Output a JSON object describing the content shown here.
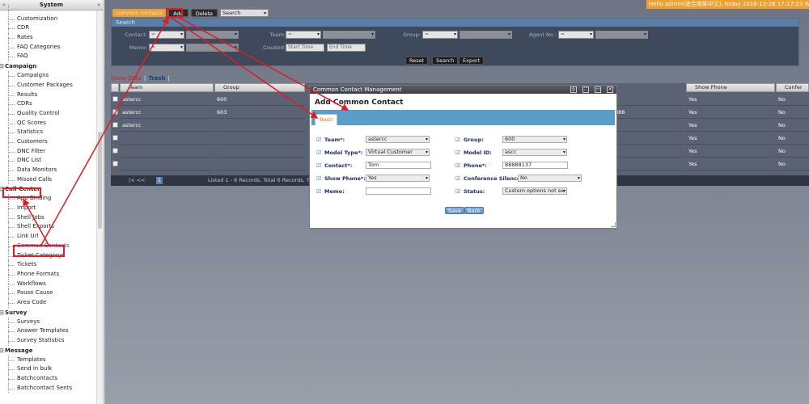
{
  "sidebar": {
    "title": "System",
    "collapse_left": "«",
    "collapse_right": "«",
    "groups": [
      {
        "label": "",
        "items": [
          "",
          "Customization",
          "CDR",
          "Rates",
          "FAQ Categories",
          "FAQ"
        ]
      },
      {
        "label": "Campaign",
        "items": [
          "Campaigns",
          "Customer Packages",
          "Results",
          "CDRs",
          "Quality Control",
          "QC Scores",
          "Statistics",
          "Customers",
          "DNC Filter",
          "DNC List",
          "Data Monitors",
          "Missed Calls"
        ]
      },
      {
        "label": "Call Center",
        "items": [
          "App Binding",
          "Import",
          "Shell Jobs",
          "Shell Exports",
          "Link Url",
          "Common Contacts",
          "Ticket Categorys",
          "Tickets",
          "Phone Formats",
          "Workflows",
          "Pause Cause",
          "Area Code"
        ]
      },
      {
        "label": "Survey",
        "items": [
          "Surveys",
          "Answer Templates",
          "Survey Statistics"
        ]
      },
      {
        "label": "Message",
        "items": [
          "Templates",
          "Send in bulk",
          "Batchcontacts",
          "Batchcontact Sents"
        ]
      }
    ]
  },
  "topbar": {
    "greeting": "Hello admin(适合简体中文), today 2016-12-28 17:17:23 Wednes"
  },
  "toolbar": {
    "tag": "common contacts",
    "add_label": "Add",
    "delete_label": "Delete",
    "search_select": "Search"
  },
  "search_panel": {
    "title": "Search",
    "labels": {
      "contact": "Contact:",
      "team": "Team:",
      "group": "Group:",
      "agent_no": "Agent No.:",
      "memo": "Memo:",
      "created": "Created:"
    },
    "op_value": "=",
    "start_placeholder": "Start Time",
    "end_placeholder": "End Time",
    "reset_label": "Reset",
    "search_label": "Search",
    "export_label": "Export"
  },
  "show_data": {
    "show": "Show Data",
    "sep": "|",
    "trash": "Trash",
    "sep2": "|"
  },
  "grid": {
    "columns": [
      "Team",
      "Group",
      "Show Phone",
      "Confer"
    ],
    "rows": [
      {
        "team": "astercc",
        "group": "600",
        "mid": "",
        "show_phone": "Yes",
        "confer": "No"
      },
      {
        "team": "astercc",
        "group": "603",
        "mid": "888",
        "show_phone": "Yes",
        "confer": "No"
      },
      {
        "team": "astercc",
        "group": "",
        "mid": "",
        "show_phone": "Yes",
        "confer": "No"
      },
      {
        "team": "",
        "group": "",
        "mid": "",
        "show_phone": "Yes",
        "confer": "No"
      },
      {
        "team": "",
        "group": "",
        "mid": "",
        "show_phone": "Yes",
        "confer": "No"
      },
      {
        "team": "",
        "group": "",
        "mid": "",
        "show_phone": "Yes",
        "confer": "No"
      }
    ],
    "pager_text": "Listed 1 - 6 Records, Total 6 Records, Total",
    "page": "1"
  },
  "dialog": {
    "title": "Common Contact Management",
    "heading": "Add Common Contact",
    "tab_basic": "Basic",
    "fields": {
      "team": {
        "label": "Team*:",
        "value": "astercc"
      },
      "group": {
        "label": "Group:",
        "value": "600"
      },
      "model_type": {
        "label": "Model Type*:",
        "value": "Virtual Customer"
      },
      "model_id": {
        "label": "Model ID:",
        "value": "ascc"
      },
      "contact": {
        "label": "Contact*:",
        "value": "Tom"
      },
      "phone": {
        "label": "Phone*:",
        "value": "88888137"
      },
      "show_phone": {
        "label": "Show Phone*:",
        "value": "Yes"
      },
      "conference_silence": {
        "label": "Conference Silence:",
        "value": "No"
      },
      "memo": {
        "label": "Memo:",
        "value": ""
      },
      "status": {
        "label": "Status:",
        "value": "Custom options not se"
      }
    },
    "save_label": "Save",
    "back_label": "Back"
  },
  "colors": {
    "highlight": "#e01b24",
    "accent_orange": "#e8a13a",
    "dialog_tab": "#5b9dc8"
  }
}
